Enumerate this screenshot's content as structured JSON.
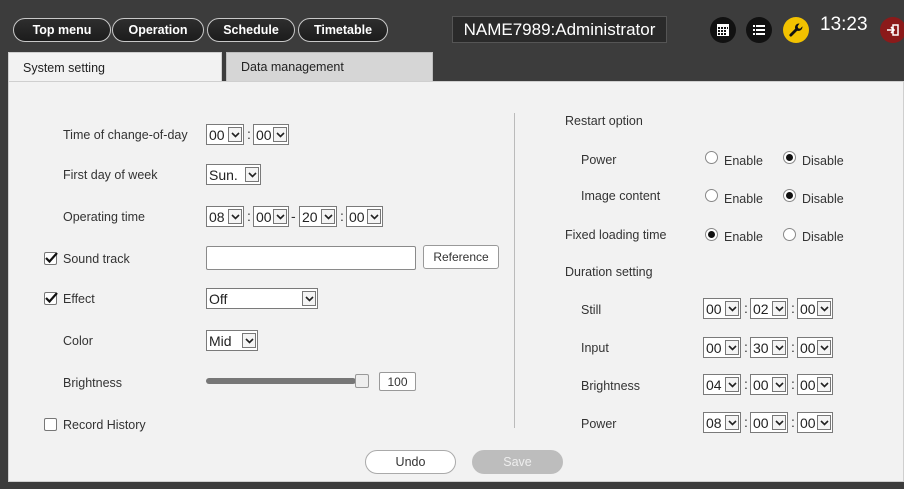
{
  "nav": {
    "top_menu": "Top menu",
    "operation": "Operation",
    "schedule": "Schedule",
    "timetable": "Timetable"
  },
  "user": "NAME7989:Administrator",
  "clock": "13:23",
  "icons": [
    "calendar-icon",
    "list-icon",
    "wrench-icon",
    "logout-icon"
  ],
  "tabs": {
    "system_setting": "System setting",
    "data_management": "Data management"
  },
  "left": {
    "change_of_day": {
      "label": "Time of change-of-day",
      "hour": "00",
      "minute": "00"
    },
    "first_day": {
      "label": "First day of week",
      "value": "Sun."
    },
    "operating_time": {
      "label": "Operating time",
      "start_h": "08",
      "start_m": "00",
      "end_h": "20",
      "end_m": "00"
    },
    "sound_track": {
      "label": "Sound track",
      "checked": true,
      "value": "",
      "button": "Reference"
    },
    "effect": {
      "label": "Effect",
      "checked": true,
      "value": "Off"
    },
    "color": {
      "label": "Color",
      "value": "Mid"
    },
    "brightness": {
      "label": "Brightness",
      "value": "100"
    },
    "record_history": {
      "label": "Record History",
      "checked": false
    }
  },
  "right": {
    "restart_option": "Restart option",
    "power": {
      "label": "Power",
      "enable": "Enable",
      "disable": "Disable",
      "selected": "Disable"
    },
    "image_content": {
      "label": "Image content",
      "enable": "Enable",
      "disable": "Disable",
      "selected": "Disable"
    },
    "fixed_loading": {
      "label": "Fixed loading time",
      "enable": "Enable",
      "disable": "Disable",
      "selected": "Enable"
    },
    "duration_setting": "Duration setting",
    "durations": [
      {
        "label": "Still",
        "h": "00",
        "m": "02",
        "s": "00"
      },
      {
        "label": "Input",
        "h": "00",
        "m": "30",
        "s": "00"
      },
      {
        "label": "Brightness",
        "h": "04",
        "m": "00",
        "s": "00"
      },
      {
        "label": "Power",
        "h": "08",
        "m": "00",
        "s": "00"
      }
    ]
  },
  "footer": {
    "undo": "Undo",
    "save": "Save"
  },
  "colors": {
    "accent": "#f2c200",
    "logout": "#8b1a1a"
  }
}
